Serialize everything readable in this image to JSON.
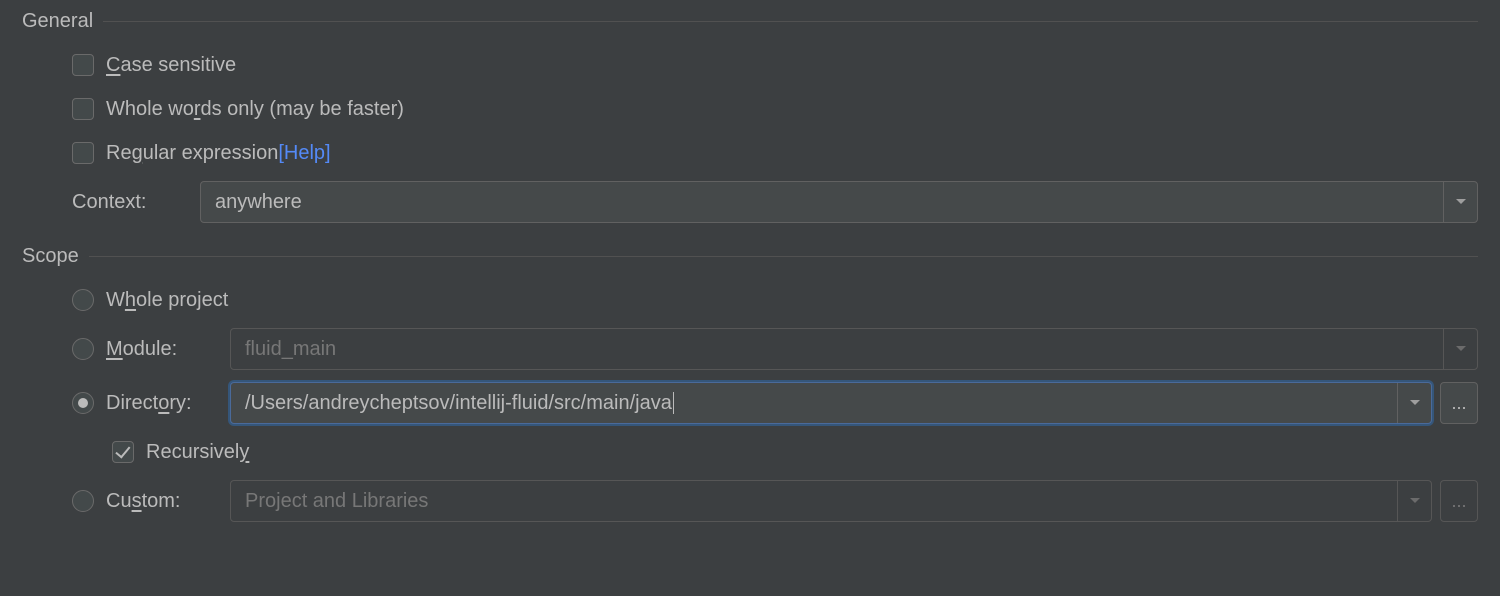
{
  "general": {
    "title": "General",
    "case_sensitive_pre": "C",
    "case_sensitive_post": "ase sensitive",
    "whole_words_pre": "Whole wo",
    "whole_words_mn": "r",
    "whole_words_post": "ds only (may be faster)",
    "regex_pre": "Re",
    "regex_mn": "g",
    "regex_post": "ular expression",
    "help": "[Help]",
    "context_label": "Context:",
    "context_value": "anywhere"
  },
  "scope": {
    "title": "Scope",
    "whole_pre": "W",
    "whole_mn": "h",
    "whole_post": "ole project",
    "module_mn": "M",
    "module_post": "odule:",
    "module_value": "fluid_main",
    "directory_pre": "Direct",
    "directory_mn": "o",
    "directory_post": "ry:",
    "directory_value": "/Users/andreycheptsov/intellij-fluid/src/main/java",
    "recursive_pre": "Recursivel",
    "recursive_mn": "y",
    "custom_pre": "Cu",
    "custom_mn": "s",
    "custom_post": "tom:",
    "custom_value": "Project and Libraries",
    "browse": "..."
  }
}
